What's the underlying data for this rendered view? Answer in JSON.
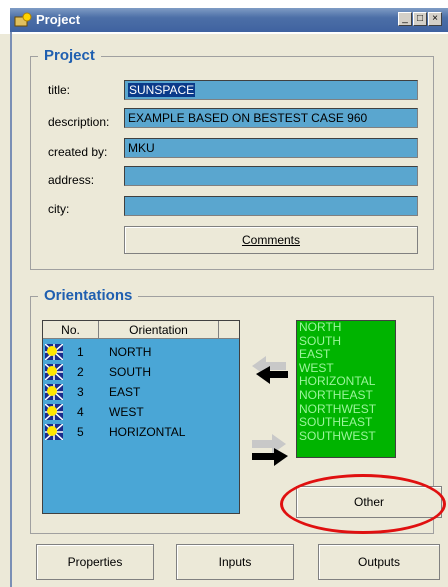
{
  "window": {
    "title": "Project",
    "minimize_label": "_",
    "maximize_label": "□",
    "close_label": "×"
  },
  "project": {
    "group_label": "Project",
    "fields": [
      {
        "label": "title:",
        "value": "SUNSPACE"
      },
      {
        "label": "description:",
        "value": "EXAMPLE BASED ON BESTEST CASE 960"
      },
      {
        "label": "created by:",
        "value": "MKU"
      },
      {
        "label": "address:",
        "value": ""
      },
      {
        "label": "city:",
        "value": ""
      }
    ],
    "comments_label": "Comments"
  },
  "orientations": {
    "group_label": "Orientations",
    "columns": [
      "No.",
      "Orientation"
    ],
    "rows": [
      {
        "no": "1",
        "name": "NORTH",
        "icon": "sun-icon"
      },
      {
        "no": "2",
        "name": "SOUTH",
        "icon": "sun-icon"
      },
      {
        "no": "3",
        "name": "EAST",
        "icon": "sun-icon"
      },
      {
        "no": "4",
        "name": "WEST",
        "icon": "sun-icon"
      },
      {
        "no": "5",
        "name": "HORIZONTAL",
        "icon": "sun-icon"
      }
    ],
    "available": [
      "NORTH",
      "SOUTH",
      "EAST",
      "WEST",
      "HORIZONTAL",
      "NORTHEAST",
      "NORTHWEST",
      "SOUTHEAST",
      "SOUTHWEST"
    ],
    "other_label": "Other",
    "highlight_color": "#e01010"
  },
  "bottom": {
    "properties_label": "Properties",
    "inputs_label": "Inputs",
    "outputs_label": "Outputs"
  },
  "colors": {
    "field_bg": "#5aa6cf",
    "list_bg": "#4aa6d6",
    "available_bg": "#00b400",
    "group_label": "#1f5fb0"
  }
}
